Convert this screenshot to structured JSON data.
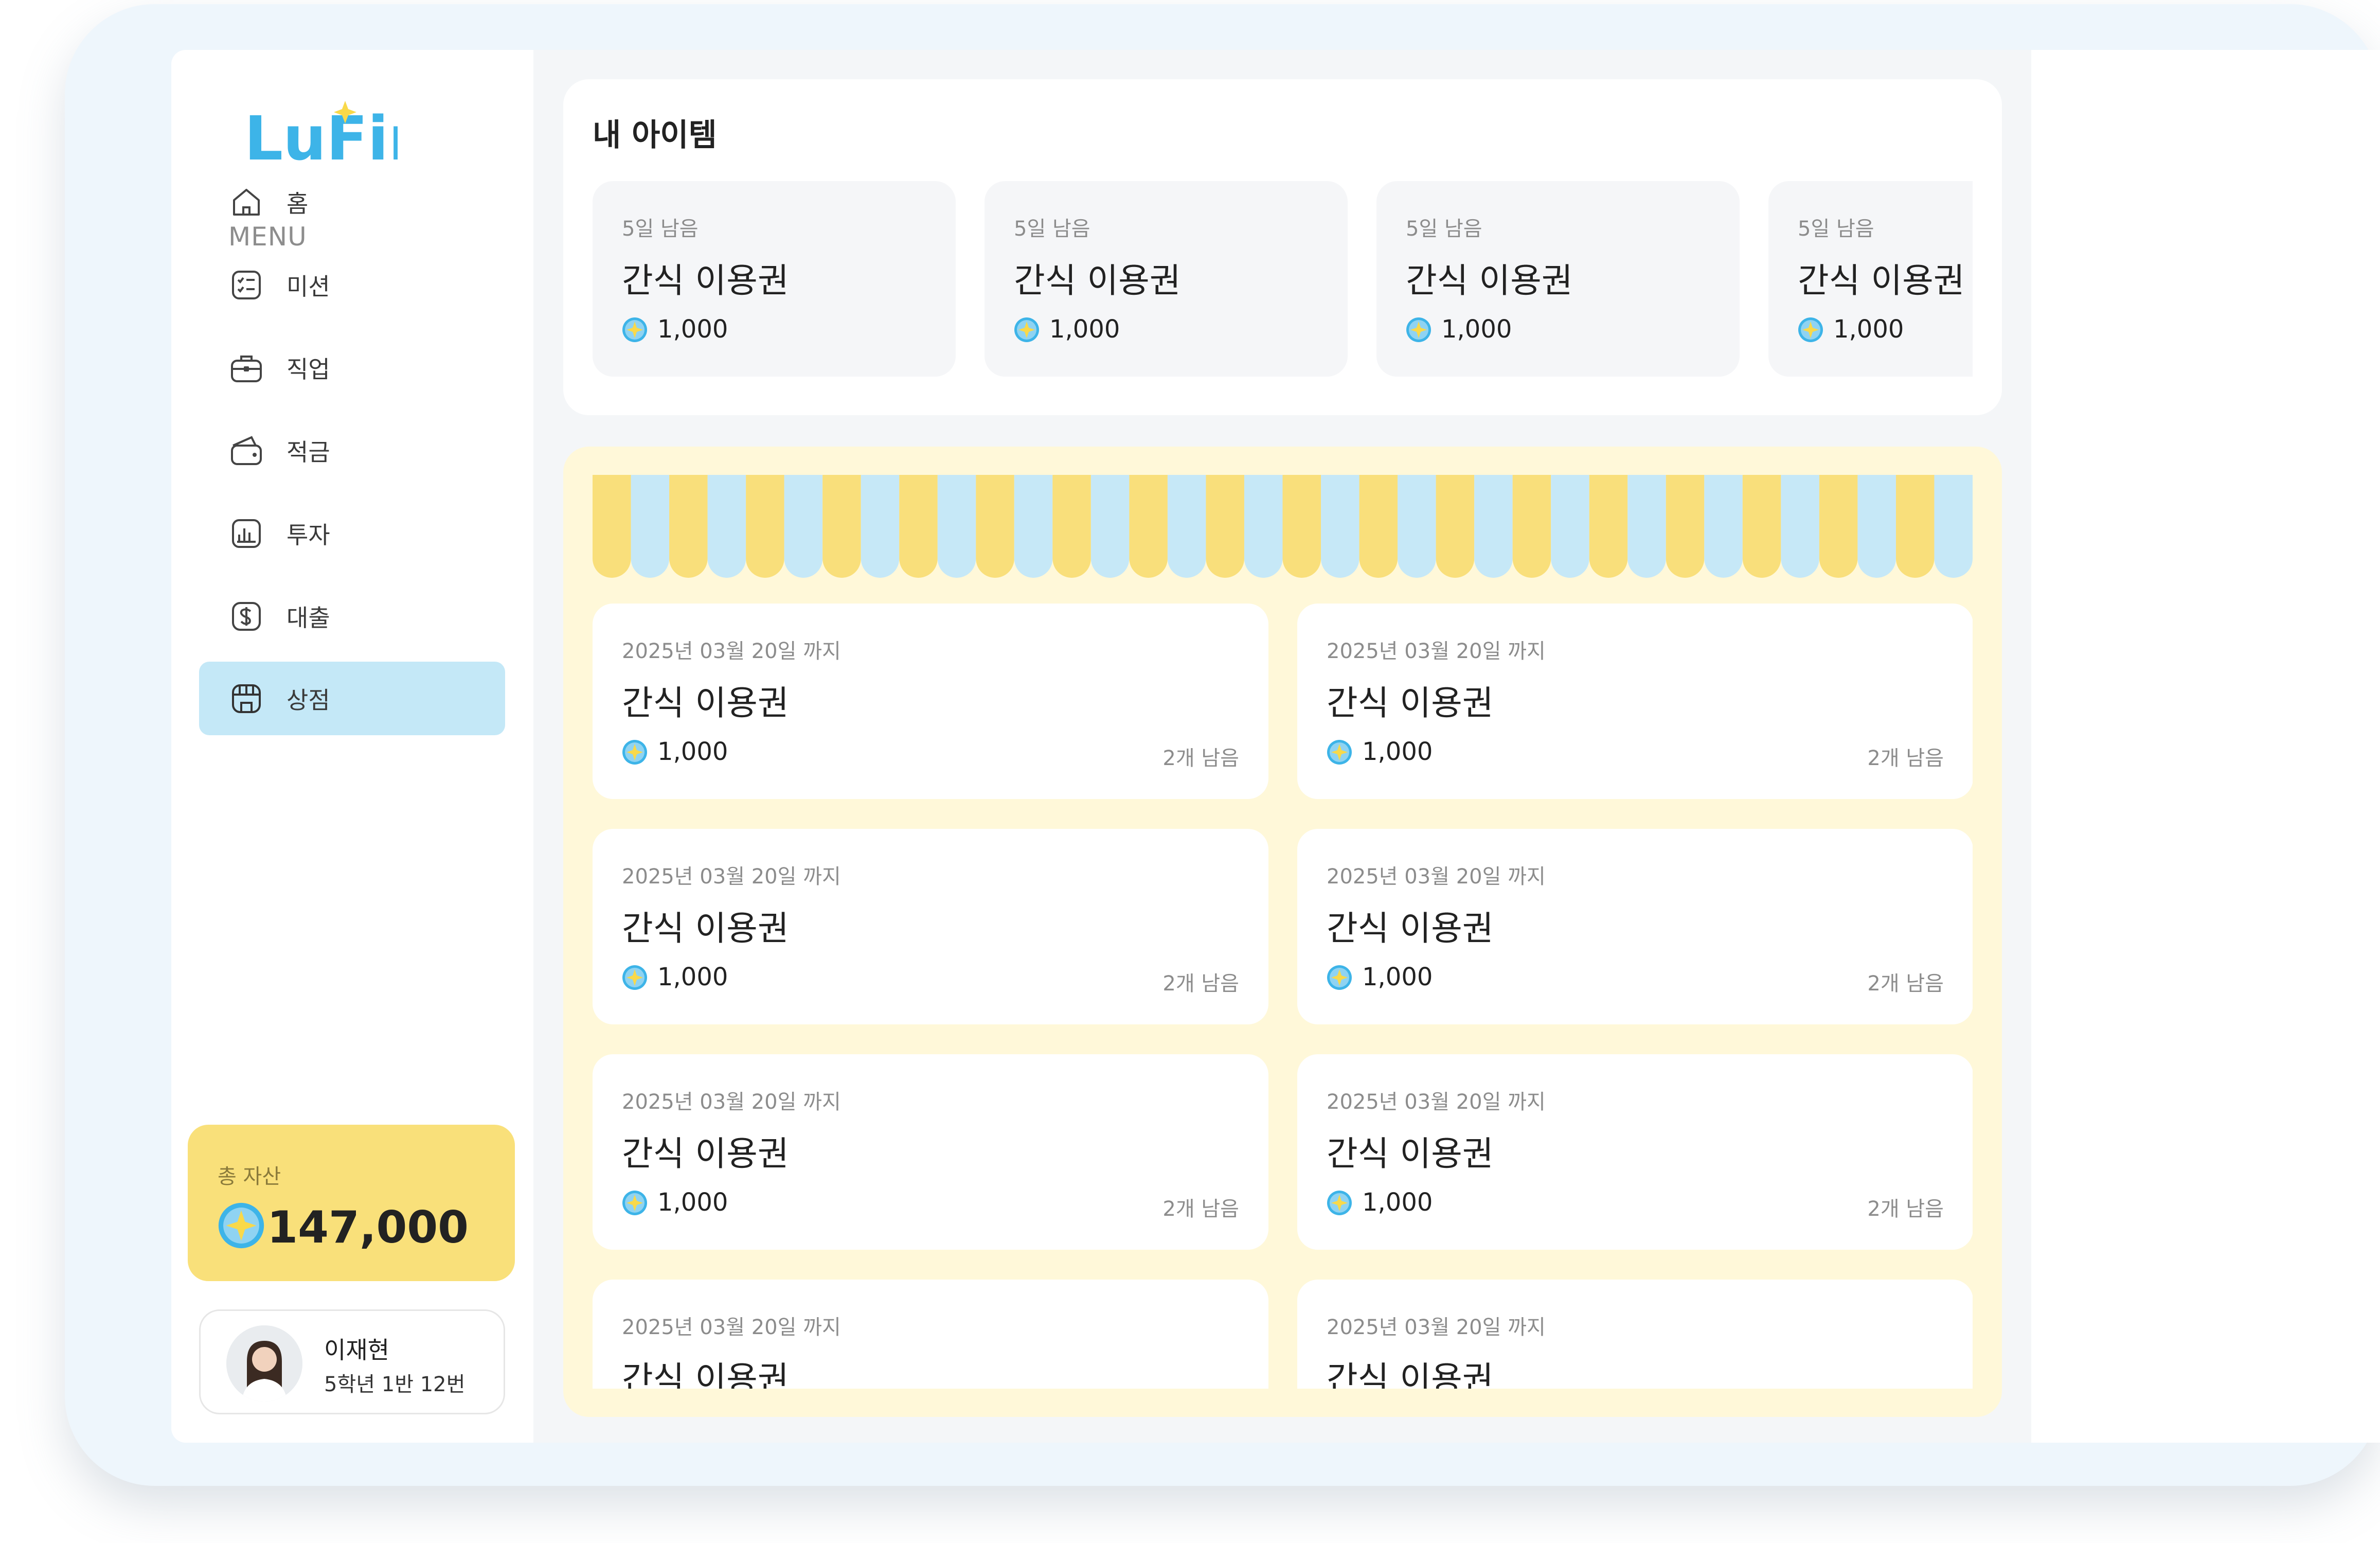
{
  "app": {
    "logo_text": "LuFin"
  },
  "sidebar": {
    "menu_heading": "MENU",
    "items": [
      {
        "label": "홈",
        "icon": "home-icon",
        "active": false
      },
      {
        "label": "미션",
        "icon": "checklist-icon",
        "active": false
      },
      {
        "label": "직업",
        "icon": "briefcase-icon",
        "active": false
      },
      {
        "label": "적금",
        "icon": "wallet-icon",
        "active": false
      },
      {
        "label": "투자",
        "icon": "chart-icon",
        "active": false
      },
      {
        "label": "대출",
        "icon": "dollar-icon",
        "active": false
      },
      {
        "label": "상점",
        "icon": "store-icon",
        "active": true
      }
    ],
    "asset": {
      "title": "총 자산",
      "amount": "147,000",
      "icon": "coin-icon"
    },
    "profile": {
      "name": "이재현",
      "class_info": "5학년 1반 12번",
      "icon": "avatar"
    }
  },
  "my_items": {
    "title": "내 아이템",
    "cards": [
      {
        "days_left": "5일 남음",
        "name": "간식 이용권",
        "price": "1,000"
      },
      {
        "days_left": "5일 남음",
        "name": "간식 이용권",
        "price": "1,000"
      },
      {
        "days_left": "5일 남음",
        "name": "간식 이용권",
        "price": "1,000"
      },
      {
        "days_left": "5일 남음",
        "name": "간식 이용권",
        "price": "1,000"
      }
    ]
  },
  "shop": {
    "items": [
      {
        "deadline": "2025년 03월 20일 까지",
        "name": "간식 이용권",
        "price": "1,000",
        "remaining": "2개 남음"
      },
      {
        "deadline": "2025년 03월 20일 까지",
        "name": "간식 이용권",
        "price": "1,000",
        "remaining": "2개 남음"
      },
      {
        "deadline": "2025년 03월 20일 까지",
        "name": "간식 이용권",
        "price": "1,000",
        "remaining": "2개 남음"
      },
      {
        "deadline": "2025년 03월 20일 까지",
        "name": "간식 이용권",
        "price": "1,000",
        "remaining": "2개 남음"
      },
      {
        "deadline": "2025년 03월 20일 까지",
        "name": "간식 이용권",
        "price": "1,000",
        "remaining": "2개 남음"
      },
      {
        "deadline": "2025년 03월 20일 까지",
        "name": "간식 이용권",
        "price": "1,000",
        "remaining": "2개 남음"
      },
      {
        "deadline": "2025년 03월 20일 까지",
        "name": "간식 이용권",
        "price": "",
        "remaining": ""
      },
      {
        "deadline": "2025년 03월 20일 까지",
        "name": "간식 이용권",
        "price": "",
        "remaining": ""
      }
    ]
  },
  "colors": {
    "brand_blue": "#3db4e8",
    "brand_yellow": "#f9d94a",
    "active_nav": "#c4e8f7",
    "asset_card": "#f9e07a",
    "shop_background": "#fff8d9",
    "awning_yellow": "#f9df7b",
    "awning_blue": "#c6e8f7"
  }
}
